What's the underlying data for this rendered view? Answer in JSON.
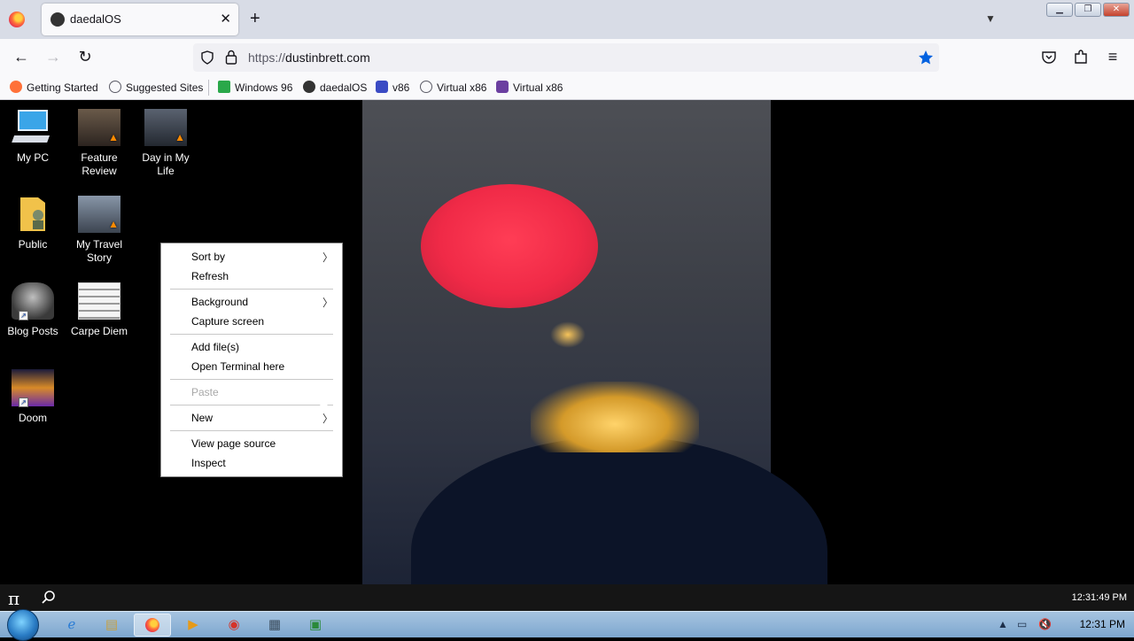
{
  "browser": {
    "tab_title": "daedalOS",
    "tab_close": "✕",
    "new_tab": "+",
    "url_scheme": "https://",
    "url_host": "dustinbrett.com",
    "bookmarks": [
      {
        "label": "Getting Started",
        "color": "#ff7139"
      },
      {
        "label": "Suggested Sites",
        "color": "#5b5b66"
      },
      {
        "label": "Windows 96",
        "color": "#2aa84a"
      },
      {
        "label": "daedalOS",
        "color": "#333333"
      },
      {
        "label": "v86",
        "color": "#3b4bc4"
      },
      {
        "label": "Virtual x86",
        "color": "#5b5b66"
      },
      {
        "label": "Virtual x86",
        "color": "#6b3fa0"
      }
    ]
  },
  "desktop": {
    "icons": [
      {
        "label": "My PC"
      },
      {
        "label": "Feature Review"
      },
      {
        "label": "Day in My Life"
      },
      {
        "label": "Public"
      },
      {
        "label": "My Travel Story"
      },
      {
        "label": "Blog Posts"
      },
      {
        "label": "Carpe Diem"
      },
      {
        "label": "Doom"
      }
    ]
  },
  "context_menu": {
    "items": [
      {
        "label": "Sort by",
        "submenu": true
      },
      {
        "label": "Refresh"
      },
      {
        "label": "Background",
        "submenu": true
      },
      {
        "label": "Capture screen"
      },
      {
        "label": "Add file(s)"
      },
      {
        "label": "Open Terminal here"
      },
      {
        "label": "Paste",
        "disabled": true
      },
      {
        "label": "New",
        "submenu": true
      },
      {
        "label": "View page source"
      },
      {
        "label": "Inspect"
      }
    ]
  },
  "daedal_taskbar": {
    "start_glyph": "π",
    "clock": "12:31:49 PM"
  },
  "windows_taskbar": {
    "clock": "12:31 PM"
  },
  "colors": {
    "accent_star": "#0061e0",
    "moon": "#f02a47"
  }
}
